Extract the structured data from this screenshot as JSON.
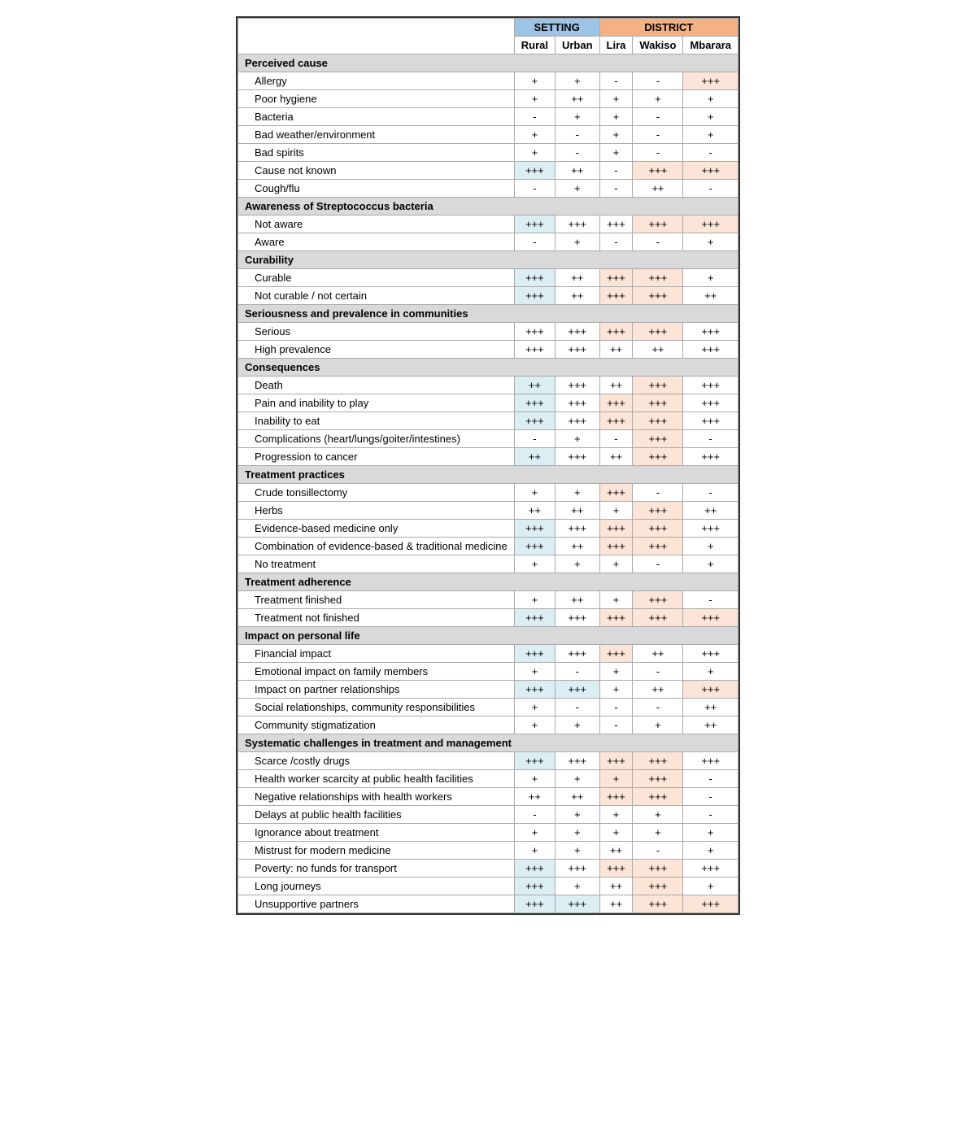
{
  "headers": {
    "setting": "SETTING",
    "district": "DISTRICT",
    "cols": [
      "Rural",
      "Urban",
      "Lira",
      "Wakiso",
      "Mbarara"
    ]
  },
  "sections": [
    {
      "title": "Perceived cause",
      "rows": [
        {
          "label": "Allergy",
          "vals": [
            "+",
            "+",
            "-",
            "-",
            "+++"
          ],
          "highlight": [
            false,
            false,
            false,
            false,
            true
          ]
        },
        {
          "label": "Poor hygiene",
          "vals": [
            "+",
            "++",
            "+",
            "+",
            "+"
          ],
          "highlight": [
            false,
            false,
            false,
            false,
            false
          ]
        },
        {
          "label": "Bacteria",
          "vals": [
            "-",
            "+",
            "+",
            "-",
            "+"
          ],
          "highlight": [
            false,
            false,
            false,
            false,
            false
          ]
        },
        {
          "label": "Bad weather/environment",
          "vals": [
            "+",
            "-",
            "+",
            "-",
            "+"
          ],
          "highlight": [
            false,
            false,
            false,
            false,
            false
          ]
        },
        {
          "label": "Bad spirits",
          "vals": [
            "+",
            "-",
            "+",
            "-",
            "-"
          ],
          "highlight": [
            false,
            false,
            false,
            false,
            false
          ]
        },
        {
          "label": "Cause not known",
          "vals": [
            "+++",
            "++",
            "-",
            "+++",
            "+++"
          ],
          "highlight": [
            true,
            false,
            false,
            true,
            true
          ]
        },
        {
          "label": "Cough/flu",
          "vals": [
            "-",
            "+",
            "-",
            "++",
            "-"
          ],
          "highlight": [
            false,
            false,
            false,
            false,
            false
          ]
        }
      ]
    },
    {
      "title": "Awareness of Streptococcus bacteria",
      "rows": [
        {
          "label": "Not aware",
          "vals": [
            "+++",
            "+++",
            "+++",
            "+++",
            "+++"
          ],
          "highlight": [
            true,
            false,
            false,
            true,
            true
          ]
        },
        {
          "label": "Aware",
          "vals": [
            "-",
            "+",
            "-",
            "-",
            "+"
          ],
          "highlight": [
            false,
            false,
            false,
            false,
            false
          ]
        }
      ]
    },
    {
      "title": "Curability",
      "rows": [
        {
          "label": "Curable",
          "vals": [
            "+++",
            "++",
            "+++",
            "+++",
            "+"
          ],
          "highlight": [
            true,
            false,
            true,
            true,
            false
          ]
        },
        {
          "label": "Not curable / not certain",
          "vals": [
            "+++",
            "++",
            "+++",
            "+++",
            "++"
          ],
          "highlight": [
            true,
            false,
            true,
            true,
            false
          ]
        }
      ]
    },
    {
      "title": "Seriousness and prevalence in communities",
      "rows": [
        {
          "label": "Serious",
          "vals": [
            "+++",
            "+++",
            "+++",
            "+++",
            "+++"
          ],
          "highlight": [
            false,
            false,
            true,
            true,
            false
          ]
        },
        {
          "label": "High prevalence",
          "vals": [
            "+++",
            "+++",
            "++",
            "++",
            "+++"
          ],
          "highlight": [
            false,
            false,
            false,
            false,
            false
          ]
        }
      ]
    },
    {
      "title": "Consequences",
      "rows": [
        {
          "label": "Death",
          "vals": [
            "++",
            "+++",
            "++",
            "+++",
            "+++"
          ],
          "highlight": [
            true,
            false,
            false,
            true,
            false
          ]
        },
        {
          "label": "Pain and inability to play",
          "vals": [
            "+++",
            "+++",
            "+++",
            "+++",
            "+++"
          ],
          "highlight": [
            true,
            false,
            true,
            true,
            false
          ]
        },
        {
          "label": "Inability to eat",
          "vals": [
            "+++",
            "+++",
            "+++",
            "+++",
            "+++"
          ],
          "highlight": [
            true,
            false,
            true,
            true,
            false
          ]
        },
        {
          "label": "Complications (heart/lungs/goiter/intestines)",
          "vals": [
            "-",
            "+",
            "-",
            "+++",
            "-"
          ],
          "highlight": [
            false,
            false,
            false,
            true,
            false
          ]
        },
        {
          "label": "Progression to cancer",
          "vals": [
            "++",
            "+++",
            "++",
            "+++",
            "+++"
          ],
          "highlight": [
            true,
            false,
            false,
            true,
            false
          ]
        }
      ]
    },
    {
      "title": "Treatment practices",
      "rows": [
        {
          "label": "Crude tonsillectomy",
          "vals": [
            "+",
            "+",
            "+++",
            "-",
            "-"
          ],
          "highlight": [
            false,
            false,
            true,
            false,
            false
          ]
        },
        {
          "label": "Herbs",
          "vals": [
            "++",
            "++",
            "+",
            "+++",
            "++"
          ],
          "highlight": [
            false,
            false,
            false,
            true,
            false
          ]
        },
        {
          "label": "Evidence-based medicine only",
          "vals": [
            "+++",
            "+++",
            "+++",
            "+++",
            "+++"
          ],
          "highlight": [
            true,
            false,
            true,
            true,
            false
          ]
        },
        {
          "label": "Combination of evidence-based & traditional medicine",
          "vals": [
            "+++",
            "++",
            "+++",
            "+++",
            "+"
          ],
          "highlight": [
            true,
            false,
            true,
            true,
            false
          ]
        },
        {
          "label": "No treatment",
          "vals": [
            "+",
            "+",
            "+",
            "-",
            "+"
          ],
          "highlight": [
            false,
            false,
            false,
            false,
            false
          ]
        }
      ]
    },
    {
      "title": "Treatment adherence",
      "rows": [
        {
          "label": "Treatment finished",
          "vals": [
            "+",
            "++",
            "+",
            "+++",
            "-"
          ],
          "highlight": [
            false,
            false,
            false,
            true,
            false
          ]
        },
        {
          "label": "Treatment not finished",
          "vals": [
            "+++",
            "+++",
            "+++",
            "+++",
            "+++"
          ],
          "highlight": [
            true,
            false,
            true,
            true,
            true
          ]
        }
      ]
    },
    {
      "title": "Impact on personal life",
      "rows": [
        {
          "label": "Financial impact",
          "vals": [
            "+++",
            "+++",
            "+++",
            "++",
            "+++"
          ],
          "highlight": [
            true,
            false,
            true,
            false,
            false
          ]
        },
        {
          "label": "Emotional impact on family members",
          "vals": [
            "+",
            "-",
            "+",
            "-",
            "+"
          ],
          "highlight": [
            false,
            false,
            false,
            false,
            false
          ]
        },
        {
          "label": "Impact on partner relationships",
          "vals": [
            "+++",
            "+++",
            "+",
            "++",
            "+++"
          ],
          "highlight": [
            true,
            true,
            false,
            false,
            true
          ]
        },
        {
          "label": "Social relationships, community responsibilities",
          "vals": [
            "+",
            "-",
            "-",
            "-",
            "++"
          ],
          "highlight": [
            false,
            false,
            false,
            false,
            false
          ]
        },
        {
          "label": "Community stigmatization",
          "vals": [
            "+",
            "+",
            "-",
            "+",
            "++"
          ],
          "highlight": [
            false,
            false,
            false,
            false,
            false
          ]
        }
      ]
    },
    {
      "title": "Systematic challenges in treatment and management",
      "rows": [
        {
          "label": "Scarce /costly drugs",
          "vals": [
            "+++",
            "+++",
            "+++",
            "+++",
            "+++"
          ],
          "highlight": [
            true,
            false,
            true,
            true,
            false
          ]
        },
        {
          "label": "Health worker scarcity at public health facilities",
          "vals": [
            "+",
            "+",
            "+",
            "+++",
            "-"
          ],
          "highlight": [
            false,
            false,
            true,
            true,
            false
          ]
        },
        {
          "label": "Negative relationships with health workers",
          "vals": [
            "++",
            "++",
            "+++",
            "+++",
            "-"
          ],
          "highlight": [
            false,
            false,
            true,
            true,
            false
          ]
        },
        {
          "label": "Delays at public health facilities",
          "vals": [
            "-",
            "+",
            "+",
            "+",
            "-"
          ],
          "highlight": [
            false,
            false,
            false,
            false,
            false
          ]
        },
        {
          "label": "Ignorance about treatment",
          "vals": [
            "+",
            "+",
            "+",
            "+",
            "+"
          ],
          "highlight": [
            false,
            false,
            false,
            false,
            false
          ]
        },
        {
          "label": "Mistrust for modern medicine",
          "vals": [
            "+",
            "+",
            "++",
            "-",
            "+"
          ],
          "highlight": [
            false,
            false,
            false,
            false,
            false
          ]
        },
        {
          "label": "Poverty: no funds for transport",
          "vals": [
            "+++",
            "+++",
            "+++",
            "+++",
            "+++"
          ],
          "highlight": [
            true,
            false,
            true,
            true,
            false
          ]
        },
        {
          "label": "Long journeys",
          "vals": [
            "+++",
            "+",
            "++",
            "+++",
            "+"
          ],
          "highlight": [
            true,
            false,
            false,
            true,
            false
          ]
        },
        {
          "label": "Unsupportive partners",
          "vals": [
            "+++",
            "+++",
            "++",
            "+++",
            "+++"
          ],
          "highlight": [
            true,
            true,
            false,
            true,
            true
          ]
        }
      ]
    }
  ]
}
